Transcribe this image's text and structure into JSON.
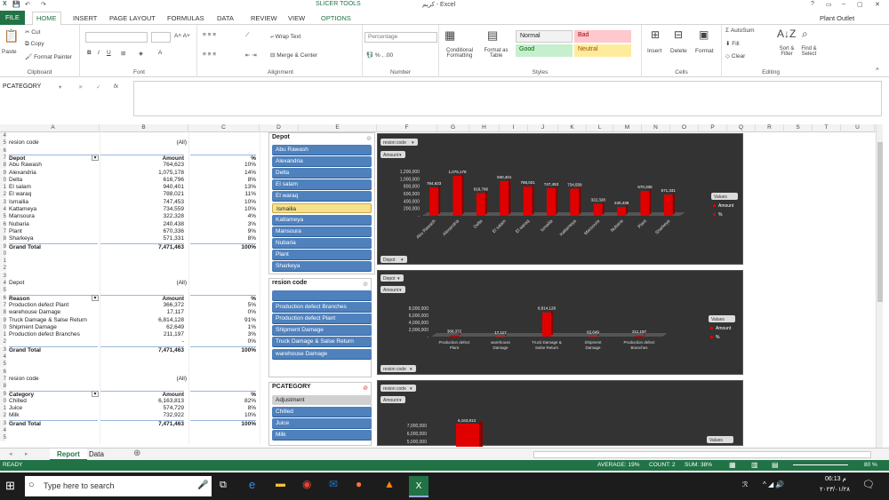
{
  "title": {
    "app": "كريم - Excel",
    "contextual": "SLICER TOOLS",
    "user": "Plant Outlet"
  },
  "tabs": [
    "FILE",
    "HOME",
    "INSERT",
    "PAGE LAYOUT",
    "FORMULAS",
    "DATA",
    "REVIEW",
    "VIEW",
    "OPTIONS"
  ],
  "ribbon": {
    "clipboard": {
      "label": "Clipboard",
      "paste": "Paste",
      "cut": "Cut",
      "copy": "Copy",
      "format_painter": "Format Painter"
    },
    "font": {
      "label": "Font"
    },
    "alignment": {
      "label": "Alignment",
      "wrap": "Wrap Text",
      "merge": "Merge & Center"
    },
    "number": {
      "label": "Number",
      "format": "Percentage"
    },
    "styles": {
      "label": "Styles",
      "conditional": "Conditional Formatting",
      "format_table": "Format as Table",
      "normal": "Normal",
      "bad": "Bad",
      "good": "Good",
      "neutral": "Neutral"
    },
    "cells": {
      "label": "Cells",
      "insert": "Insert",
      "delete": "Delete",
      "format": "Format"
    },
    "editing": {
      "label": "Editing",
      "autosum": "AutoSum",
      "fill": "Fill",
      "clear": "Clear",
      "sort": "Sort & Filter",
      "find": "Find & Select"
    }
  },
  "formula_bar": {
    "name_box": "PCATEGORY",
    "fx": "fx",
    "value": ""
  },
  "columns": [
    "A",
    "B",
    "C",
    "D",
    "E",
    "F",
    "G",
    "H",
    "I",
    "J",
    "K",
    "L",
    "M",
    "N",
    "O",
    "P",
    "Q",
    "R",
    "S",
    "T",
    "U"
  ],
  "pivot1": {
    "filter_label": "resion code",
    "filter_value": "(All)",
    "header": [
      "Depot",
      "Amount",
      "%"
    ],
    "rows": [
      [
        "Abu Rawash",
        "764,623",
        "10%"
      ],
      [
        "Alexandria",
        "1,075,178",
        "14%"
      ],
      [
        "Delta",
        "616,796",
        "8%"
      ],
      [
        "El salam",
        "940,401",
        "13%"
      ],
      [
        "El waraq",
        "788,021",
        "11%"
      ],
      [
        "Ismailia",
        "747,453",
        "10%"
      ],
      [
        "Kattameya",
        "734,559",
        "10%"
      ],
      [
        "Mansoura",
        "322,328",
        "4%"
      ],
      [
        "Nubaria",
        "240,438",
        "3%"
      ],
      [
        "Plant",
        "670,336",
        "9%"
      ],
      [
        "Sharkeya",
        "571,331",
        "8%"
      ]
    ],
    "total": [
      "Grand Total",
      "7,471,463",
      "100%"
    ]
  },
  "pivot2": {
    "filter_label": "Depot",
    "filter_value": "(All)",
    "header": [
      "Reason",
      "Amount",
      "%"
    ],
    "rows": [
      [
        "Production defect Plant",
        "366,372",
        "5%"
      ],
      [
        "warehouse Damage",
        "17,117",
        "0%"
      ],
      [
        "Truck Damage & Salse Return",
        "6,814,128",
        "91%"
      ],
      [
        "Shipment Damage",
        "62,649",
        "1%"
      ],
      [
        "Production defect Branches",
        "211,197",
        "3%"
      ],
      [
        "",
        "-",
        "0%"
      ]
    ],
    "total": [
      "Grand Total",
      "7,471,463",
      "100%"
    ]
  },
  "pivot3": {
    "filter_label": "resion code",
    "filter_value": "(All)",
    "header": [
      "Category",
      "Amount",
      "%"
    ],
    "rows": [
      [
        "Chilled",
        "6,163,813",
        "82%"
      ],
      [
        "Juice",
        "574,729",
        "8%"
      ],
      [
        "Milk",
        "732,922",
        "10%"
      ]
    ],
    "total": [
      "Grand Total",
      "7,471,463",
      "100%"
    ]
  },
  "slicer_depot": {
    "title": "Depot",
    "items": [
      "Abu Rawash",
      "Alexandria",
      "Delta",
      "El salam",
      "El waraq",
      "Ismailia",
      "Kattameya",
      "Mansoura",
      "Nubaria",
      "Plant",
      "Sharkeya"
    ],
    "selected": "Ismailia"
  },
  "slicer_reason": {
    "title": "resion code",
    "items": [
      "",
      "Production defect Branches",
      "Production defect Plant",
      "Shipment Damage",
      "Truck Damage & Salse Return",
      "warehouse Damage"
    ]
  },
  "slicer_category": {
    "title": "PCATEGORY",
    "items": [
      "Adjustment",
      "Chilled",
      "Juice",
      "Milk"
    ]
  },
  "chart1": {
    "pills": [
      "resion code",
      "Amount",
      "Depot"
    ],
    "legend_title": "Values",
    "legend": [
      "Amount",
      "%"
    ],
    "yticks": [
      "1,200,000",
      "1,000,000",
      "800,000",
      "600,000",
      "400,000",
      "200,000",
      "-"
    ],
    "ylim": [
      0,
      1200000
    ],
    "categories": [
      "Abu Rawash",
      "Alexandria",
      "Delta",
      "El salam",
      "El waraq",
      "Ismailia",
      "Kattameya",
      "Mansoura",
      "Nubaria",
      "Plant",
      "Sharkeya"
    ],
    "values": [
      764623,
      1075178,
      616796,
      940401,
      788021,
      747453,
      734559,
      322328,
      240438,
      670336,
      571331
    ],
    "labels": [
      "764,623",
      "1,075,178",
      "616,796",
      "940,401",
      "788,021",
      "747,453",
      "734,559",
      "322,328",
      "240,438",
      "670,336",
      "571,331"
    ]
  },
  "chart2": {
    "pills": [
      "Depot",
      "Amount",
      "resion code"
    ],
    "legend_title": "Values",
    "legend": [
      "Amount",
      "%"
    ],
    "yticks": [
      "8,000,000",
      "6,000,000",
      "4,000,000",
      "2,000,000",
      "-"
    ],
    "ylim": [
      0,
      8000000
    ],
    "categories": [
      "Production defect Plant",
      "warehouse Damage",
      "Truck Damage & Salse Return",
      "Shipment Damage",
      "Production defect Branches"
    ],
    "values": [
      366372,
      17117,
      6814128,
      62649,
      211197
    ],
    "labels": [
      "366,372",
      "17,117",
      "6,814,128",
      "62,649",
      "211,197"
    ]
  },
  "chart3": {
    "pills": [
      "resion code",
      "Amount"
    ],
    "legend_title": "Values",
    "yticks": [
      "7,000,000",
      "6,000,000",
      "5,000,000"
    ],
    "label": "6,163,813"
  },
  "sheet_tabs": [
    "Report",
    "Data"
  ],
  "status": {
    "ready": "READY",
    "average": "AVERAGE: 19%",
    "count": "COUNT: 2",
    "sum": "SUM: 38%",
    "zoom": "80 %"
  },
  "taskbar": {
    "search": "Type here to search",
    "time": "06:13 م",
    "date": "٢٠٢٣/٠١/٢٨"
  },
  "colors": {
    "excel_green": "#217346",
    "slicer_blue": "#4f81bd",
    "bar_red": "#e00000",
    "chart_bg": "#333333"
  }
}
